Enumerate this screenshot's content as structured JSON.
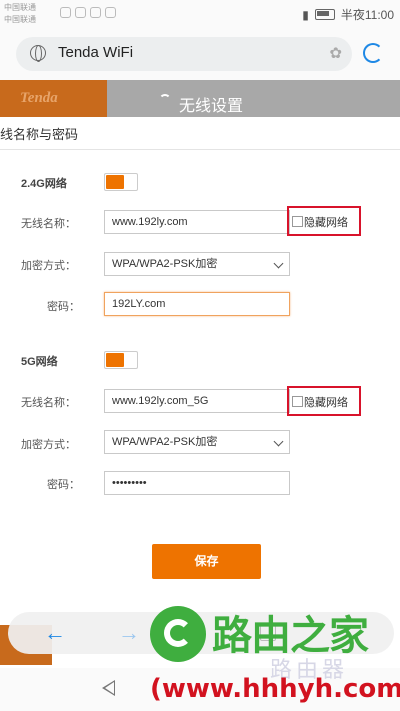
{
  "status_bar": {
    "carrier_1": "中国联通",
    "carrier_2": "中国联通",
    "time": "半夜11:00"
  },
  "browser": {
    "url": "Tenda WiFi"
  },
  "page_header": {
    "brand": "Tenda",
    "title": "无线设置"
  },
  "dialog": {
    "title": "线名称与密码",
    "band_24": {
      "section": "2.4G网络",
      "ssid_label": "无线名称：",
      "ssid_value": "www.192ly.com",
      "hide_label": "隐藏网络",
      "security_label": "加密方式：",
      "security_value": "WPA/WPA2-PSK加密",
      "password_label": "密码：",
      "password_value": "192LY.com"
    },
    "band_5": {
      "section": "5G网络",
      "ssid_label": "无线名称：",
      "ssid_value": "www.192ly.com_5G",
      "hide_label": "隐藏网络",
      "security_label": "加密方式：",
      "security_value": "WPA/WPA2-PSK加密",
      "password_label": "密码：",
      "password_value": "•••••••••"
    },
    "save_label": "保存"
  },
  "watermark": {
    "text": "路由之家",
    "sub": "路由器",
    "url": "(www.hhhyh.com)"
  },
  "colors": {
    "accent": "#ee7300",
    "highlight": "#d8132b",
    "brand": "#c86a1c",
    "link": "#1e88e5",
    "watermark_green": "#3fae3f"
  },
  "icons": [
    "globe-icon",
    "paw-icon",
    "reload-icon",
    "wifi-icon",
    "back-arrow-icon",
    "forward-arrow-icon",
    "tabs-icon",
    "system-back-icon"
  ]
}
